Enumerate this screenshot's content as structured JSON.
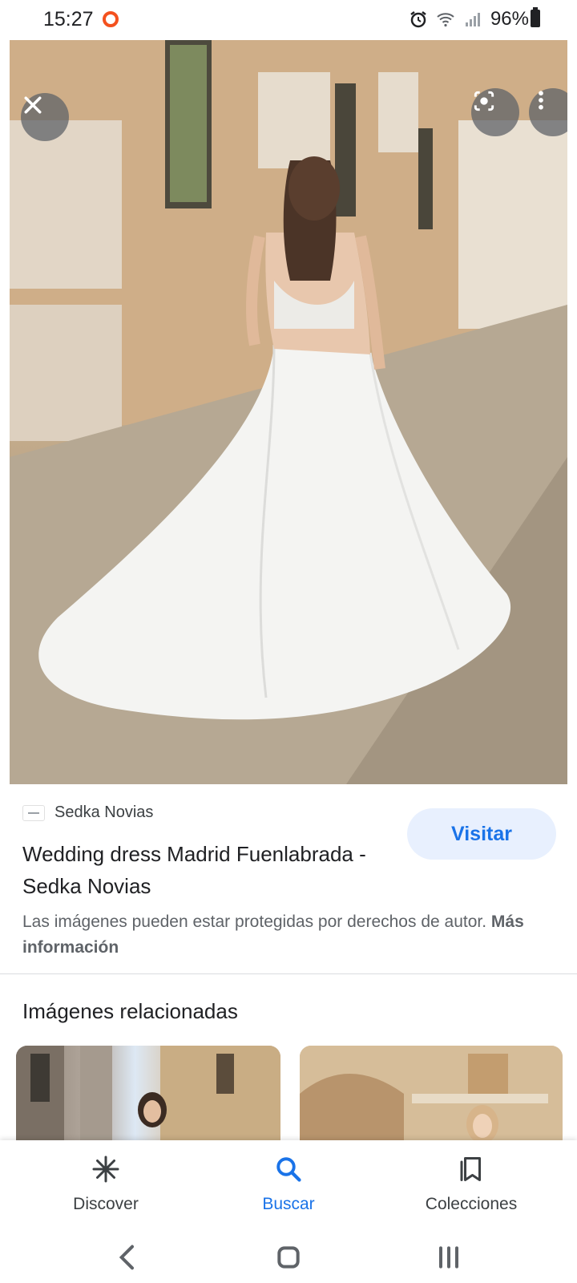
{
  "status_bar": {
    "time": "15:27",
    "battery": "96%"
  },
  "hero": {
    "icons": {
      "close": "close-icon",
      "lens": "lens-icon",
      "menu": "more-vert-icon"
    }
  },
  "result": {
    "source_name": "Sedka Novias",
    "title": "Wedding dress Madrid Fuenlabrada - Sedka Novias",
    "visit_label": "Visitar",
    "notice_text": "Las imágenes pueden estar protegidas por derechos de autor.",
    "notice_link": "Más información"
  },
  "related": {
    "heading": "Imágenes relacionadas"
  },
  "bottom_nav": {
    "items": [
      {
        "label": "Discover",
        "icon": "discover-icon",
        "active": false
      },
      {
        "label": "Buscar",
        "icon": "search-icon",
        "active": true
      },
      {
        "label": "Colecciones",
        "icon": "collections-icon",
        "active": false
      }
    ]
  },
  "colors": {
    "accent": "#1a73e8",
    "visit_bg": "#e8f0fe"
  }
}
